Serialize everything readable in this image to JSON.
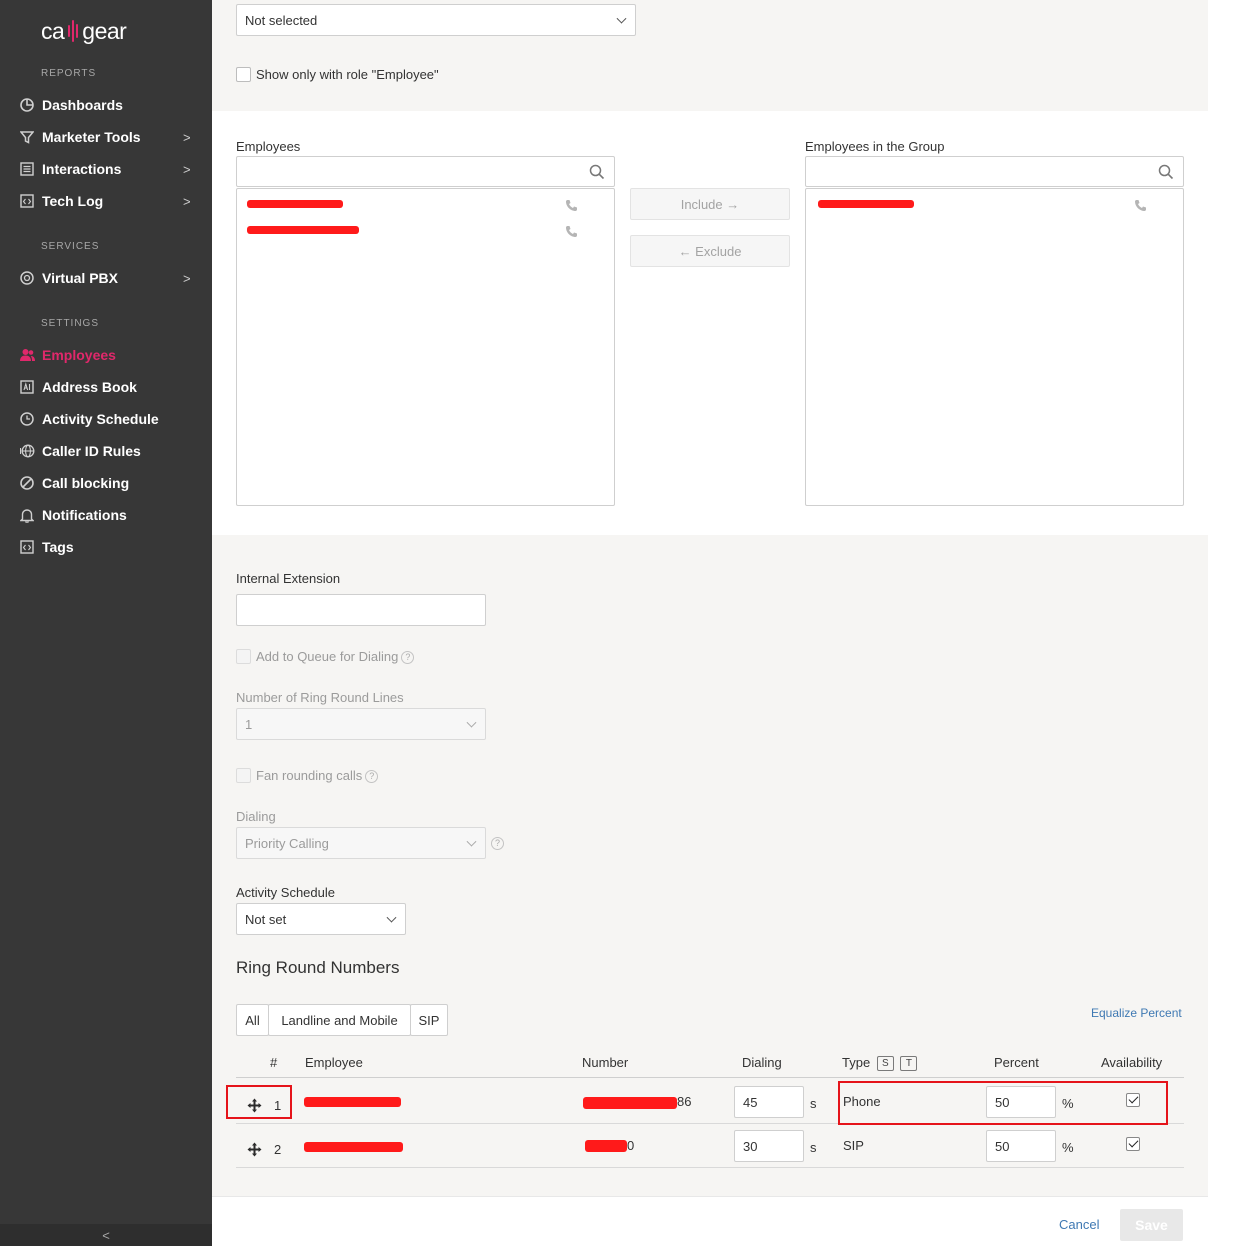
{
  "brand": {
    "logo_left": "ca",
    "logo_right": "gear",
    "accent": "#e0286b"
  },
  "sidebar": {
    "sections": {
      "reports": "REPORTS",
      "services": "SERVICES",
      "settings": "SETTINGS"
    },
    "items": [
      {
        "label": "Dashboards",
        "icon": "pie-chart-icon"
      },
      {
        "label": "Marketer Tools",
        "icon": "funnel-icon",
        "chevron": ">"
      },
      {
        "label": "Interactions",
        "icon": "list-icon",
        "chevron": ">"
      },
      {
        "label": "Tech Log",
        "icon": "code-doc-icon",
        "chevron": ">"
      },
      {
        "label": "Virtual PBX",
        "icon": "pbx-icon",
        "chevron": ">"
      },
      {
        "label": "Employees",
        "icon": "users-icon",
        "active": true
      },
      {
        "label": "Address Book",
        "icon": "address-book-icon"
      },
      {
        "label": "Activity Schedule",
        "icon": "clock-icon"
      },
      {
        "label": "Caller ID Rules",
        "icon": "globe-icon"
      },
      {
        "label": "Call blocking",
        "icon": "block-icon"
      },
      {
        "label": "Notifications",
        "icon": "bell-icon"
      },
      {
        "label": "Tags",
        "icon": "tag-icon"
      }
    ],
    "collapse": "<"
  },
  "filter": {
    "select_value": "Not selected",
    "role_checkbox_label": "Show only with role \"Employee\""
  },
  "employees": {
    "left_title": "Employees",
    "right_title": "Employees in the Group",
    "include_label": "Include →",
    "exclude_label": "← Exclude"
  },
  "settings": {
    "internal_extension_label": "Internal Extension",
    "internal_extension_value": "",
    "queue_label": "Add to Queue for Dialing",
    "ring_lines_label": "Number of Ring Round Lines",
    "ring_lines_value": "1",
    "fan_label": "Fan rounding calls",
    "dialing_label": "Dialing",
    "dialing_value": "Priority Calling",
    "schedule_label": "Activity Schedule",
    "schedule_value": "Not set",
    "help_glyph": "?"
  },
  "ring_round": {
    "title": "Ring Round Numbers",
    "tabs": [
      "All",
      "Landline and Mobile",
      "SIP"
    ],
    "equalize_label": "Equalize Percent",
    "columns": {
      "index": "#",
      "employee": "Employee",
      "number": "Number",
      "dialing": "Dialing",
      "type": "Type",
      "type_badge_s": "S",
      "type_badge_t": "T",
      "percent": "Percent",
      "availability": "Availability"
    },
    "rows": [
      {
        "index": "1",
        "number_suffix": "86",
        "dialing": "45",
        "dialing_unit": "s",
        "type": "Phone",
        "percent": "50",
        "percent_unit": "%",
        "available": true
      },
      {
        "index": "2",
        "number_suffix": "0",
        "dialing": "30",
        "dialing_unit": "s",
        "type": "SIP",
        "percent": "50",
        "percent_unit": "%",
        "available": true
      }
    ]
  },
  "footer": {
    "cancel_label": "Cancel",
    "save_label": "Save"
  }
}
